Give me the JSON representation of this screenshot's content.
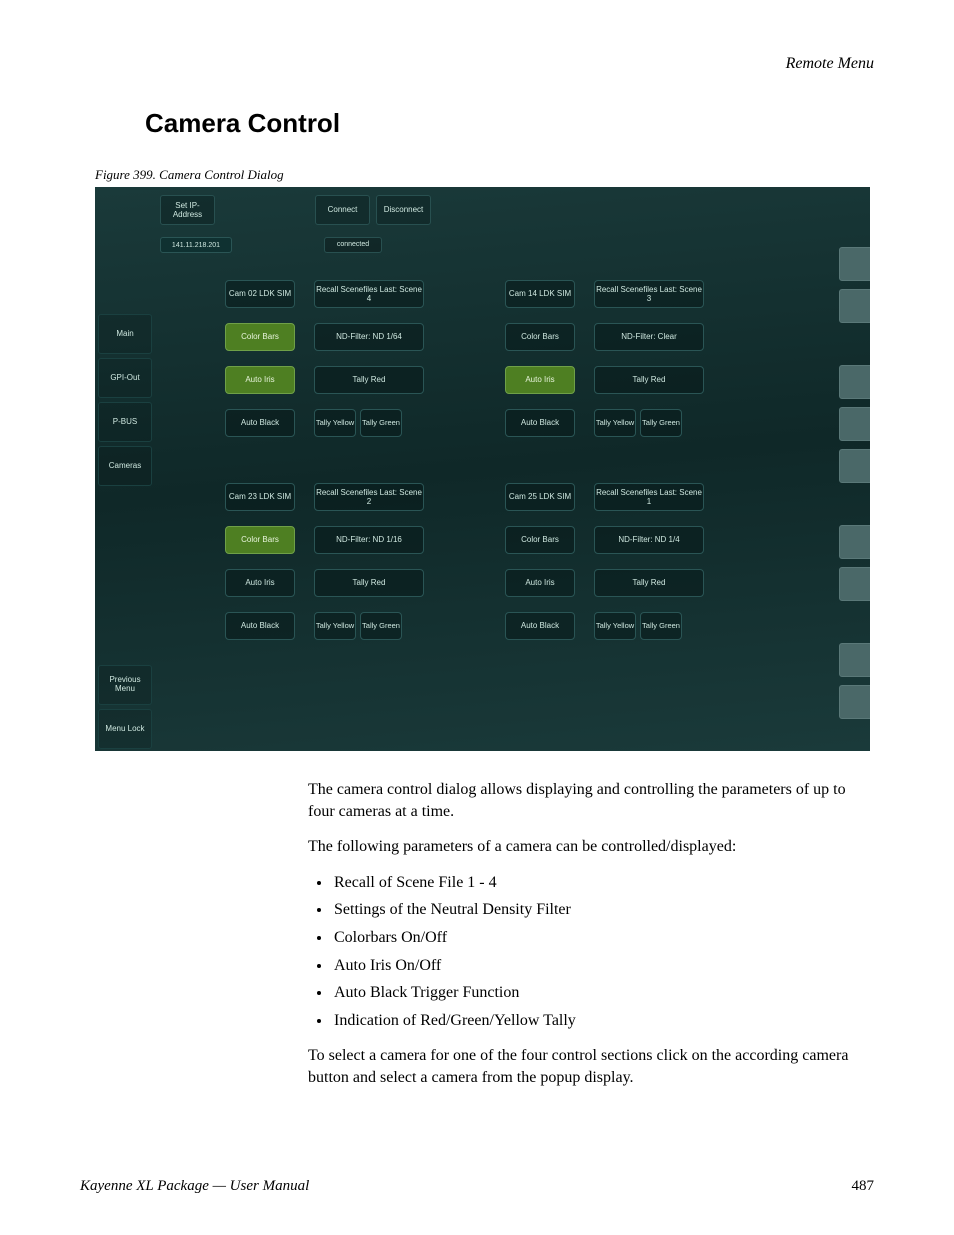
{
  "page": {
    "header_right": "Remote Menu",
    "section_title": "Camera Control",
    "figure_caption": "Figure 399.  Camera Control Dialog",
    "footer_left": "Kayenne XL Package  —  User Manual",
    "footer_page": "487"
  },
  "screenshot": {
    "top": {
      "set_ip": "Set IP-\nAddress",
      "connect": "Connect",
      "disconnect": "Disconnect",
      "ip_value": "141.11.218.201",
      "status": "connected"
    },
    "sidebar": {
      "main": "Main",
      "gpi_out": "GPI-Out",
      "pbus": "P-BUS",
      "cameras": "Cameras",
      "prev_menu": "Previous\nMenu",
      "menu_lock": "Menu\nLock"
    },
    "cameras": [
      {
        "id": "Cam 02\nLDK SIM",
        "recall": "Recall Scenefiles\nLast: Scene 4",
        "colorbars": "Color Bars",
        "colorbars_active": true,
        "nd": "ND-Filter: ND 1/64",
        "autoiris": "Auto Iris",
        "autoiris_active": true,
        "tally_red": "Tally Red",
        "autoblack": "Auto Black",
        "tally_yellow": "Tally\nYellow",
        "tally_green": "Tally\nGreen"
      },
      {
        "id": "Cam 14\nLDK SIM",
        "recall": "Recall Scenefiles\nLast: Scene 3",
        "colorbars": "Color Bars",
        "colorbars_active": false,
        "nd": "ND-Filter: Clear",
        "autoiris": "Auto Iris",
        "autoiris_active": true,
        "tally_red": "Tally Red",
        "autoblack": "Auto Black",
        "tally_yellow": "Tally\nYellow",
        "tally_green": "Tally\nGreen"
      },
      {
        "id": "Cam 23\nLDK SIM",
        "recall": "Recall Scenefiles\nLast: Scene 2",
        "colorbars": "Color Bars",
        "colorbars_active": true,
        "nd": "ND-Filter: ND 1/16",
        "autoiris": "Auto Iris",
        "autoiris_active": false,
        "tally_red": "Tally Red",
        "autoblack": "Auto Black",
        "tally_yellow": "Tally\nYellow",
        "tally_green": "Tally\nGreen"
      },
      {
        "id": "Cam 25\nLDK SIM",
        "recall": "Recall Scenefiles\nLast: Scene 1",
        "colorbars": "Color Bars",
        "colorbars_active": false,
        "nd": "ND-Filter: ND 1/4",
        "autoiris": "Auto Iris",
        "autoiris_active": false,
        "tally_red": "Tally Red",
        "autoblack": "Auto Black",
        "tally_yellow": "Tally\nYellow",
        "tally_green": "Tally\nGreen"
      }
    ]
  },
  "prose": {
    "p1": "The camera control dialog allows displaying and controlling the parameters of up to four cameras at a time.",
    "p2": "The following parameters of a camera can be controlled/displayed:",
    "bullets": [
      "Recall of Scene File 1 - 4",
      "Settings of the Neutral Density Filter",
      "Colorbars On/Off",
      "Auto Iris On/Off",
      "Auto Black Trigger Function",
      "Indication of Red/Green/Yellow Tally"
    ],
    "p3": "To select a camera for one of the four control sections click on the according camera button and select a camera from the popup display."
  }
}
